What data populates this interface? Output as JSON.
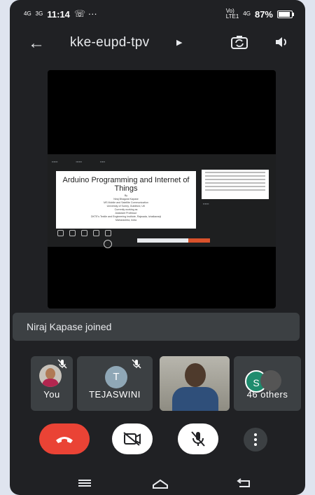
{
  "status_bar": {
    "signal1": "4G",
    "signal2": "3G",
    "time": "11:14",
    "network": "Vo)\nLTE1",
    "network_type": "4G",
    "battery": "87%",
    "battery_level": 0.87
  },
  "header": {
    "meeting_code": "kke-eupd-tpv",
    "icons": [
      "back-arrow-icon",
      "caret-right-icon",
      "switch-camera-icon",
      "speaker-icon"
    ]
  },
  "shared_screen": {
    "slide_title": "Arduino Programming and Internet of Things",
    "slide_lines": [
      "By",
      "Niraj Bhagwat Kapase",
      "MS Mobile and Satellite Communication",
      "University of Surrey, Guildford, UK",
      "Currently working as",
      "Assistant Professor",
      "DKTE's Textile and Engineering Institute, Rajwada, Ichalkaranji",
      "Maharashtra, India"
    ]
  },
  "notification": "Niraj Kapase joined",
  "participants": {
    "you_label": "You",
    "tejaswini_label": "TEJASWINI",
    "tejaswini_initial": "T",
    "others_label": "46 others",
    "others_initial": "S"
  },
  "controls": [
    "end-call-button",
    "camera-toggle-button",
    "mic-toggle-button",
    "more-options-button"
  ],
  "colors": {
    "background": "#202124",
    "tile": "#3c4043",
    "end_call": "#ea4335",
    "accent_green": "#1f8c6e"
  }
}
